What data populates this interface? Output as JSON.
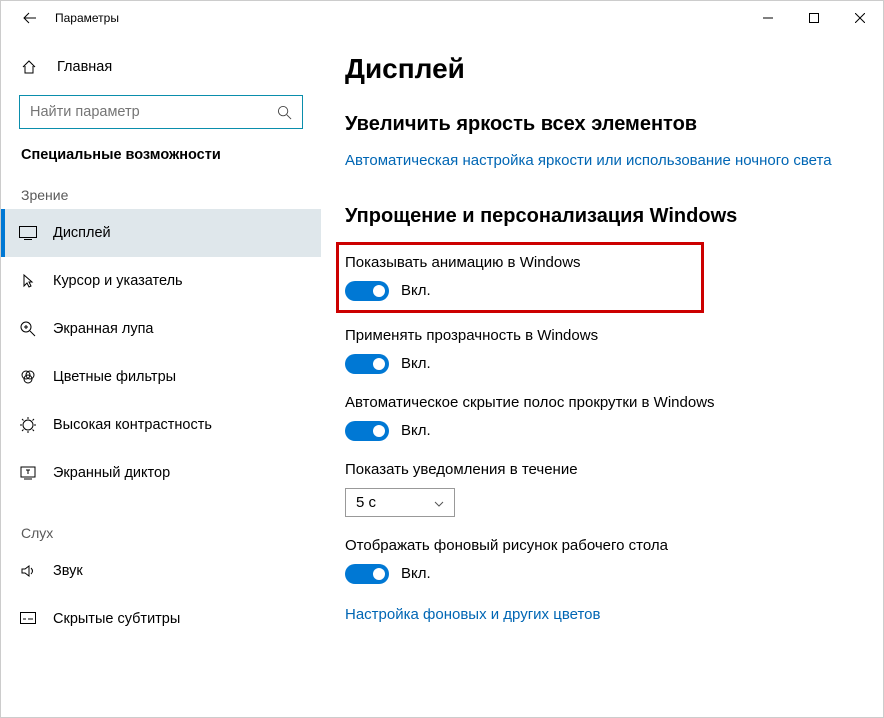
{
  "titlebar": {
    "label": "Параметры"
  },
  "sidebar": {
    "home": "Главная",
    "search_placeholder": "Найти параметр",
    "category": "Специальные возможности",
    "group_vision": "Зрение",
    "group_hearing": "Слух",
    "items_vision": [
      {
        "label": "Дисплей"
      },
      {
        "label": "Курсор и указатель"
      },
      {
        "label": "Экранная лупа"
      },
      {
        "label": "Цветные фильтры"
      },
      {
        "label": "Высокая контрастность"
      },
      {
        "label": "Экранный диктор"
      }
    ],
    "items_hearing": [
      {
        "label": "Звук"
      },
      {
        "label": "Скрытые субтитры"
      }
    ]
  },
  "main": {
    "page_title": "Дисплей",
    "section_brightness": "Увеличить яркость всех элементов",
    "link_brightness": "Автоматическая настройка яркости или использование ночного света",
    "section_simplify": "Упрощение и персонализация Windows",
    "toggle_anim_label": "Показывать анимацию в Windows",
    "toggle_anim_state": "Вкл.",
    "toggle_transp_label": "Применять прозрачность в Windows",
    "toggle_transp_state": "Вкл.",
    "toggle_scroll_label": "Автоматическое скрытие полос прокрутки в Windows",
    "toggle_scroll_state": "Вкл.",
    "notif_label": "Показать уведомления в течение",
    "notif_value": "5 с",
    "toggle_wallpaper_label": "Отображать фоновый рисунок рабочего стола",
    "toggle_wallpaper_state": "Вкл.",
    "link_colors": "Настройка фоновых и других цветов"
  }
}
